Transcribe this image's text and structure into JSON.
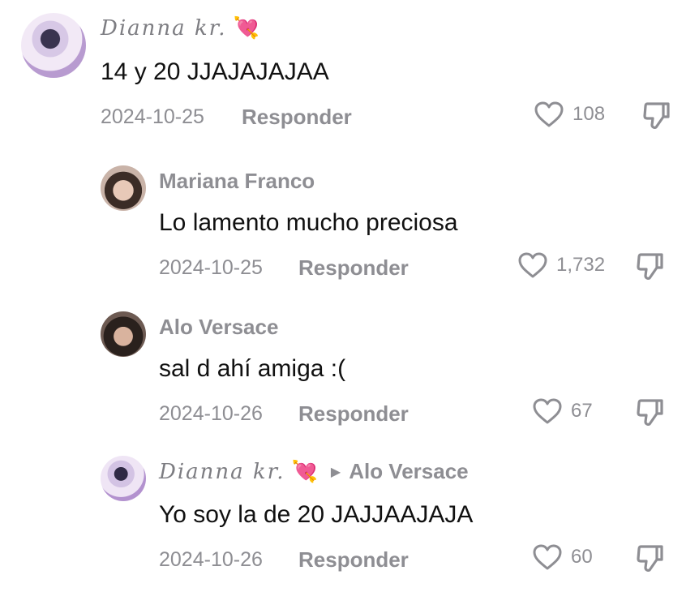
{
  "comments": [
    {
      "author": "Dianna kr.",
      "author_emoji": "💘",
      "text": "14 y 20 JJAJAJAJAA",
      "date": "2024-10-25",
      "reply_label": "Responder",
      "likes": "108"
    },
    {
      "author": "Mariana Franco",
      "text": "Lo lamento mucho preciosa",
      "date": "2024-10-25",
      "reply_label": "Responder",
      "likes": "1,732"
    },
    {
      "author": "Alo Versace",
      "text": "sal d ahí amiga :(",
      "date": "2024-10-26",
      "reply_label": "Responder",
      "likes": "67"
    },
    {
      "author": "Dianna kr.",
      "author_emoji": "💘",
      "reply_to": "Alo Versace",
      "text": "Yo soy la de 20 JAJJAAJAJA",
      "date": "2024-10-26",
      "reply_label": "Responder",
      "likes": "60"
    }
  ],
  "icons": {
    "like": "heart-outline-icon",
    "dislike": "thumbs-down-icon",
    "reply_arrow": "triangle-right-icon"
  },
  "colors": {
    "muted": "#8e8e93",
    "text": "#111111",
    "emoji_heart": "#e63a8a"
  }
}
